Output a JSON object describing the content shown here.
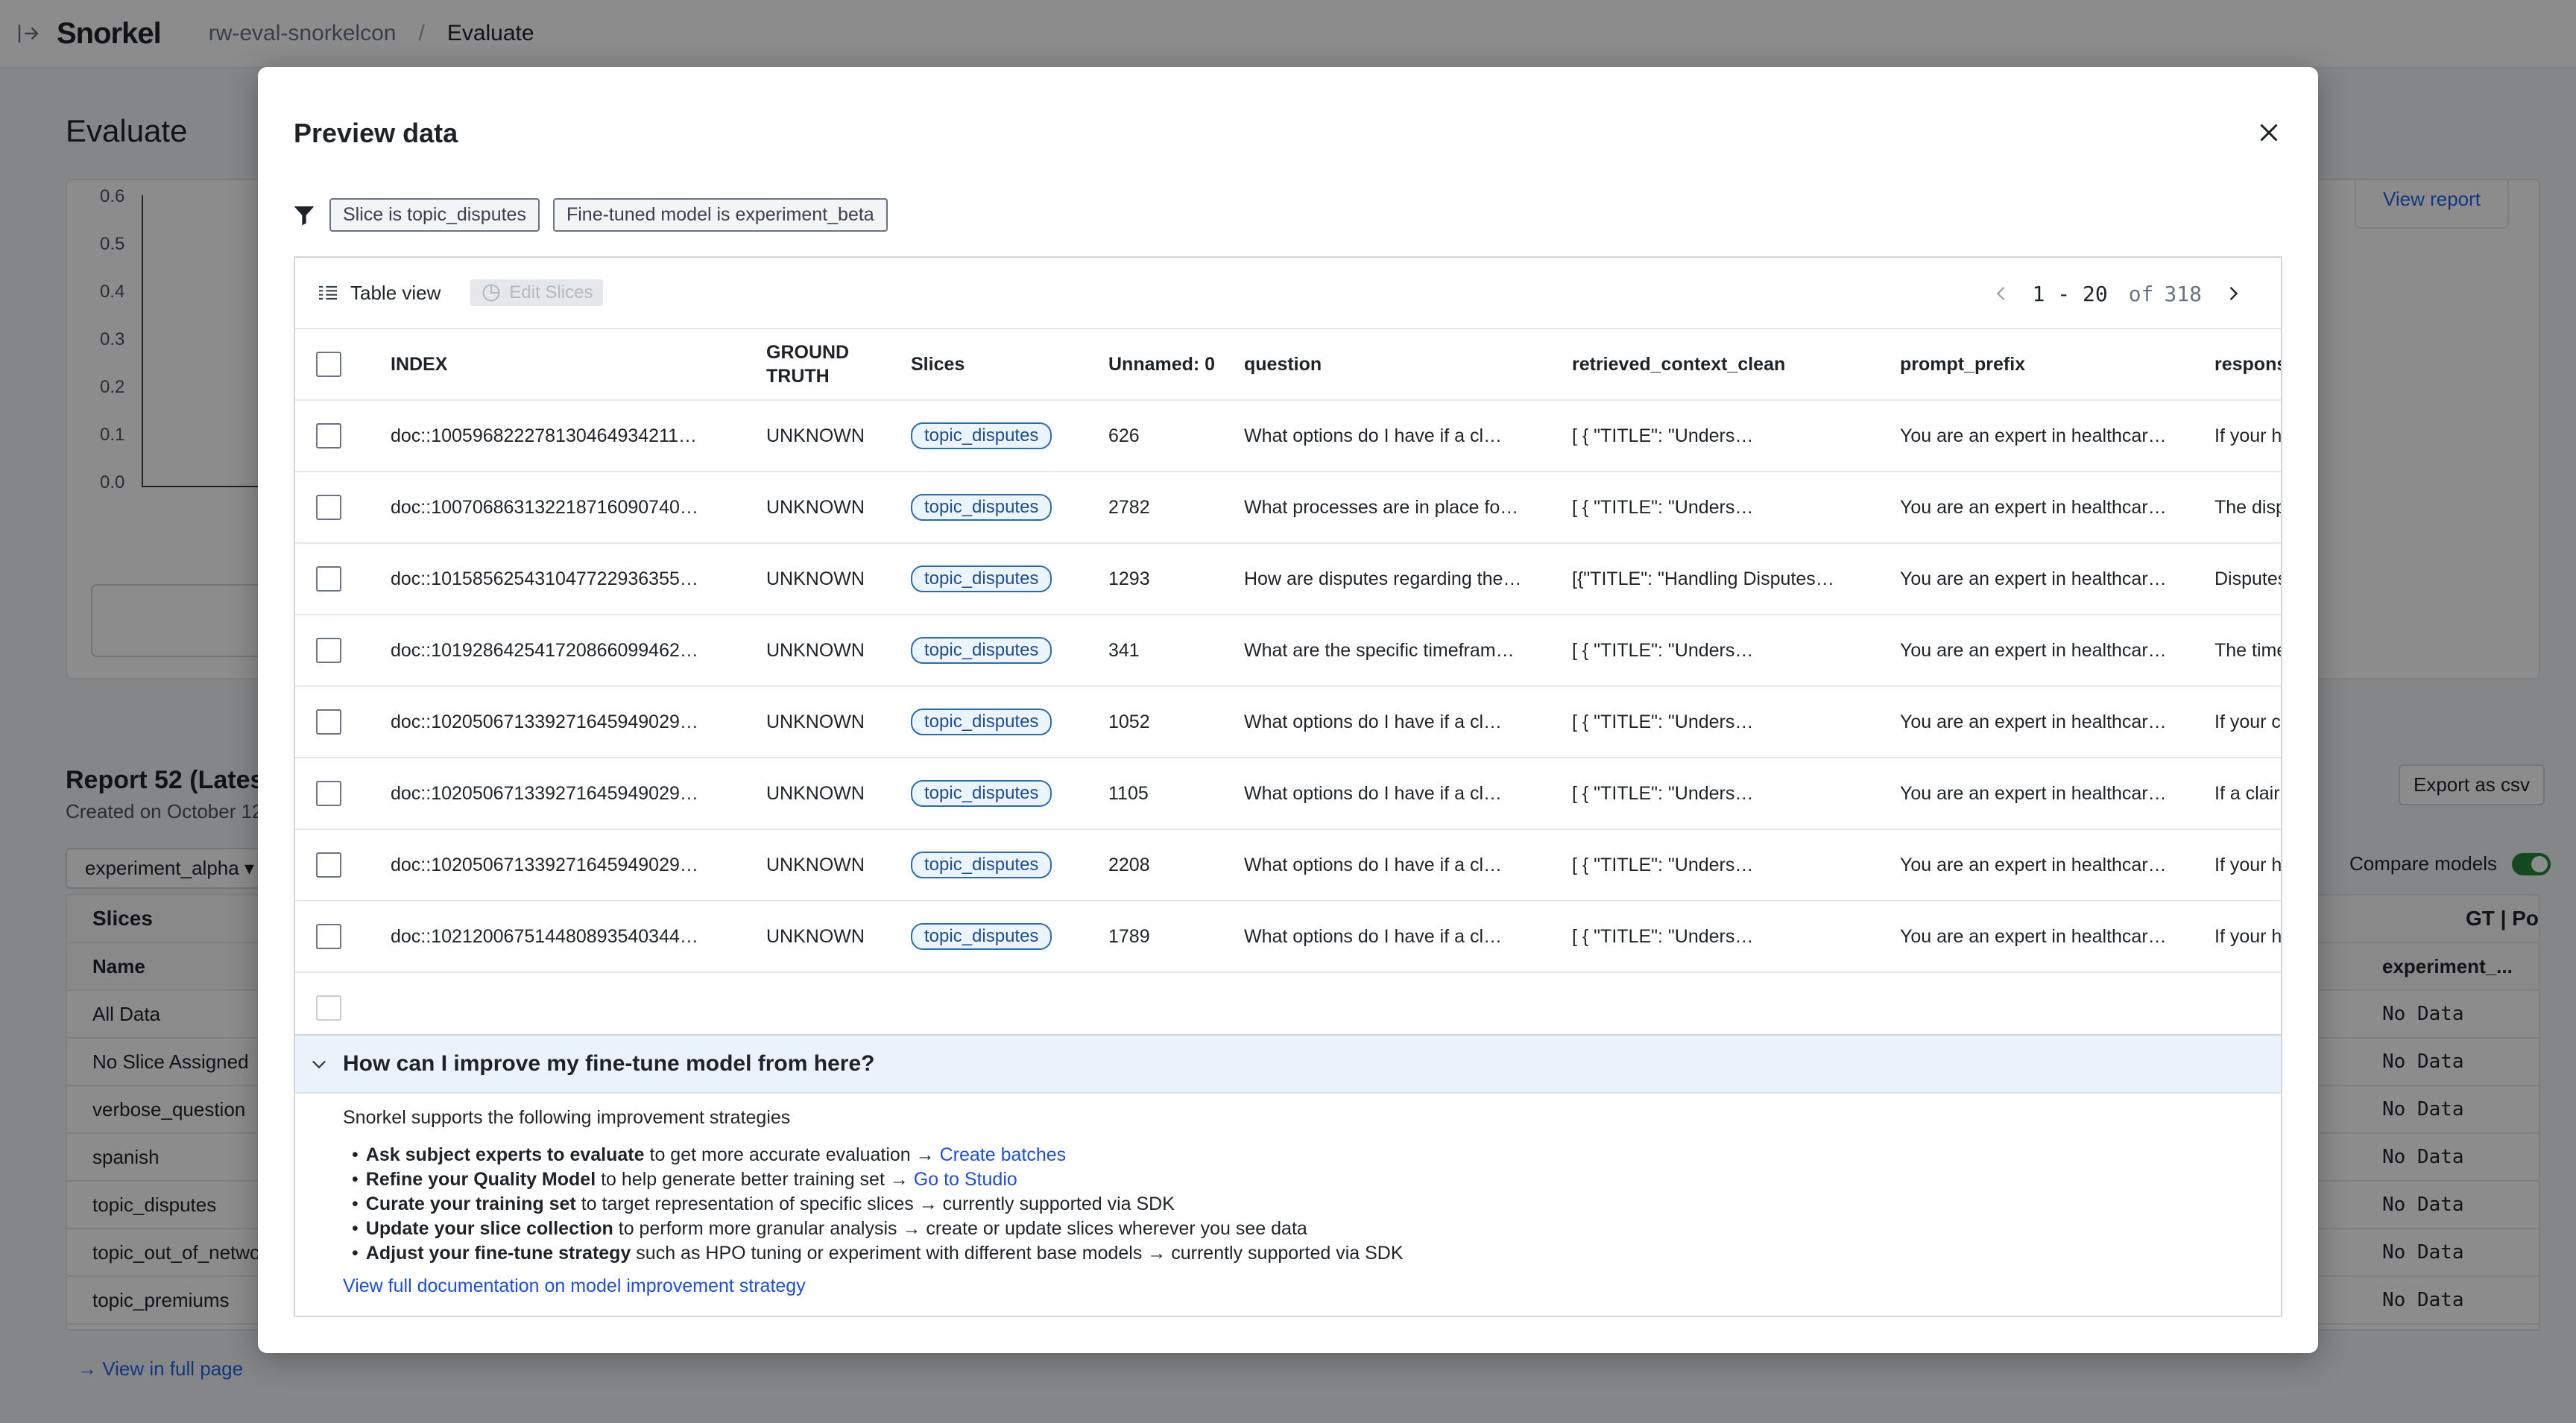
{
  "topbar": {
    "logo": "Snorkel",
    "breadcrumb_project": "rw-eval-snorkelcon",
    "breadcrumb_sep": "/",
    "breadcrumb_current": "Evaluate"
  },
  "page": {
    "title": "Evaluate",
    "view_report": "View report",
    "y_ticks": [
      "0.6",
      "0.5",
      "0.4",
      "0.3",
      "0.2",
      "0.1",
      "0.0"
    ],
    "report_title": "Report 52 (Lates",
    "report_sub": "Created on October 12",
    "export_csv": "Export as csv",
    "model_select": "experiment_alpha ▾",
    "compare_models": "Compare models",
    "slices_header": "Slices",
    "gt_header": "GT | Po",
    "name_header": "Name",
    "exp_header": "experiment_...",
    "slice_rows": [
      {
        "name": "All Data",
        "value": "No Data"
      },
      {
        "name": "No Slice Assigned",
        "value": "No Data"
      },
      {
        "name": "verbose_question",
        "value": "No Data"
      },
      {
        "name": "spanish",
        "value": "No Data"
      },
      {
        "name": "topic_disputes",
        "value": "No Data"
      },
      {
        "name": "topic_out_of_networ",
        "value": "No Data"
      },
      {
        "name": "topic_premiums",
        "value": "No Data"
      }
    ],
    "view_full_page": "→ View in full page"
  },
  "modal": {
    "title": "Preview data",
    "filters": [
      "Slice is topic_disputes",
      "Fine-tuned model is experiment_beta"
    ],
    "table_view_label": "Table view",
    "edit_slices_label": "Edit Slices",
    "pager": {
      "range": "1 - 20",
      "of": "of",
      "total": "318"
    },
    "columns": [
      "INDEX",
      "GROUND TRUTH",
      "Slices",
      "Unnamed: 0",
      "question",
      "retrieved_context_clean",
      "prompt_prefix",
      "respons"
    ],
    "rows": [
      {
        "index": "doc::100596822278130464934211…",
        "gt": "UNKNOWN",
        "slice": "topic_disputes",
        "unnamed": "626",
        "question": "What options do I have if a cl…",
        "context": "[ { \"TITLE\": \"Unders…",
        "prefix": "You are an expert in healthcar…",
        "response": "If your h"
      },
      {
        "index": "doc::100706863132218716090740…",
        "gt": "UNKNOWN",
        "slice": "topic_disputes",
        "unnamed": "2782",
        "question": "What processes are in place fo…",
        "context": "[ { \"TITLE\": \"Unders…",
        "prefix": "You are an expert in healthcar…",
        "response": "The disp"
      },
      {
        "index": "doc::101585625431047722936355…",
        "gt": "UNKNOWN",
        "slice": "topic_disputes",
        "unnamed": "1293",
        "question": "How are disputes regarding the…",
        "context": "[{\"TITLE\": \"Handling Disputes…",
        "prefix": "You are an expert in healthcar…",
        "response": "Disputes"
      },
      {
        "index": "doc::101928642541720866099462…",
        "gt": "UNKNOWN",
        "slice": "topic_disputes",
        "unnamed": "341",
        "question": "What are the specific timefram…",
        "context": "[ { \"TITLE\": \"Unders…",
        "prefix": "You are an expert in healthcar…",
        "response": "The time"
      },
      {
        "index": "doc::102050671339271645949029…",
        "gt": "UNKNOWN",
        "slice": "topic_disputes",
        "unnamed": "1052",
        "question": "What options do I have if a cl…",
        "context": "[ { \"TITLE\": \"Unders…",
        "prefix": "You are an expert in healthcar…",
        "response": "If your c"
      },
      {
        "index": "doc::102050671339271645949029…",
        "gt": "UNKNOWN",
        "slice": "topic_disputes",
        "unnamed": "1105",
        "question": "What options do I have if a cl…",
        "context": "[ { \"TITLE\": \"Unders…",
        "prefix": "You are an expert in healthcar…",
        "response": "If a clair"
      },
      {
        "index": "doc::102050671339271645949029…",
        "gt": "UNKNOWN",
        "slice": "topic_disputes",
        "unnamed": "2208",
        "question": "What options do I have if a cl…",
        "context": "[ { \"TITLE\": \"Unders…",
        "prefix": "You are an expert in healthcar…",
        "response": "If your h"
      },
      {
        "index": "doc::102120067514480893540344…",
        "gt": "UNKNOWN",
        "slice": "topic_disputes",
        "unnamed": "1789",
        "question": "What options do I have if a cl…",
        "context": "[ { \"TITLE\": \"Unders…",
        "prefix": "You are an expert in healthcar…",
        "response": "If your h"
      }
    ],
    "help": {
      "title": "How can I improve my fine-tune model from here?",
      "intro": "Snorkel supports the following improvement strategies",
      "items": [
        {
          "bold": "Ask subject experts to evaluate",
          "text": " to get more accurate evaluation → ",
          "link": "Create batches"
        },
        {
          "bold": "Refine your Quality Model",
          "text": " to help generate better training set → ",
          "link": "Go to Studio"
        },
        {
          "bold": "Curate your training set",
          "text": " to target representation of specific slices → currently supported via SDK",
          "link": ""
        },
        {
          "bold": "Update your slice collection",
          "text": " to perform more granular analysis → create or update slices wherever you see data",
          "link": ""
        },
        {
          "bold": "Adjust your fine-tune strategy",
          "text": " such as HPO tuning or experiment with different base models → currently supported via SDK",
          "link": ""
        }
      ],
      "doc_link": "View full documentation on model improvement strategy"
    }
  }
}
